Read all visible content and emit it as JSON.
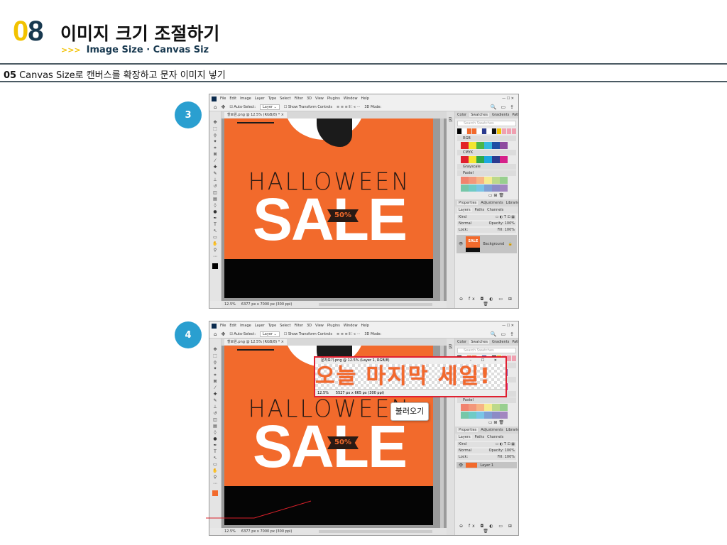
{
  "header": {
    "chapter_a": "0",
    "chapter_b": "8",
    "title": "이미지 크기 조절하기",
    "sub_arrow": ">>>",
    "subtitle": "Image Size · Canvas Siz"
  },
  "section": {
    "num": "05",
    "text": "Canvas Size로 캔버스를 확장하고 문자 이미지 넣기"
  },
  "steps": [
    "3",
    "4"
  ],
  "ps": {
    "menu": [
      "File",
      "Edit",
      "Image",
      "Layer",
      "Type",
      "Select",
      "Filter",
      "3D",
      "View",
      "Plugins",
      "Window",
      "Help"
    ],
    "win_controls": "—  ☐  ✕",
    "auto_select": "☑ Auto-Select:",
    "layer_sel": "Layer ⌄",
    "transform": "☐ Show Transform Controls",
    "mode3d": "3D Mode:",
    "doc_tab": "할로윈.png @ 12.5% (RGB/8) * ×",
    "zoom": "12.5%",
    "docinfo": "6377 px x 7000 px (300 ppi)",
    "panel_tabs": [
      "Color",
      "Swatches",
      "Gradients",
      "Patterns"
    ],
    "search": "Search Swatches",
    "groups": [
      "RGB",
      "CMYK",
      "Grayscale",
      "Pastel"
    ],
    "prop_tabs": [
      "Properties",
      "Adjustments",
      "Libraries"
    ],
    "layer_tabs": [
      "Layers",
      "Paths",
      "Channels"
    ],
    "kind": "Kind",
    "blend": "Normal",
    "opacity": "Opacity: 100%",
    "lock": "Lock:",
    "fill": "Fill: 100%",
    "layer1": "Background",
    "layer2": "Layer 1",
    "bottom_icons": "⊖ fx ◘ ◐ ▭ ⊞ 🗑",
    "canvas": {
      "halloween": "HALLOWEEN",
      "sale": "SALE",
      "badge": "50%"
    }
  },
  "popup": {
    "title": "문자모기.png @ 12.5% (Layer 1, RGB/8)",
    "text": "오늘 마지막 세일!",
    "zoom": "12.5%",
    "info": "5527 px x 665 px (300 ppi)"
  },
  "tooltip": "불러오기",
  "colors": {
    "accent": "#f2c200",
    "navy": "#17384f",
    "orange": "#f26a2c",
    "step": "#2a9fd0",
    "red": "#e02030"
  }
}
